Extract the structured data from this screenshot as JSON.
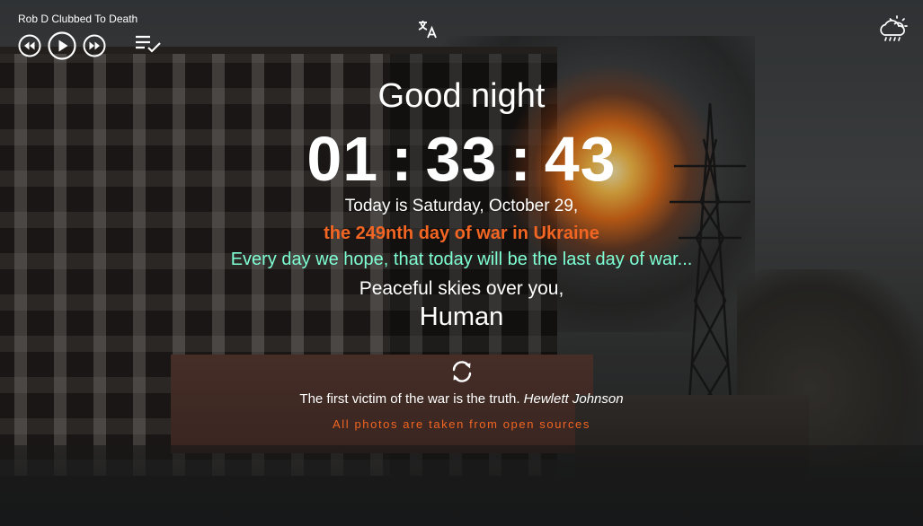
{
  "player": {
    "track_title": "Rob D Clubbed To Death",
    "icons": [
      "rewind-icon",
      "play-icon",
      "fast-forward-icon",
      "playlist-icon"
    ]
  },
  "header": {
    "translate_icon": "translate-icon",
    "weather_icon": "cloud-rain-sun-icon"
  },
  "main": {
    "greeting": "Good night",
    "clock": {
      "hours": "01",
      "minutes": "33",
      "seconds": "43",
      "separator": ":"
    },
    "today": "Today is Saturday, October 29,",
    "war_day": "the 249nth day of war in Ukraine",
    "hope": "Every day we hope, that today will be the last day of war...",
    "peace": "Peaceful skies over you,",
    "name": "Human",
    "refresh_icon": "refresh-icon",
    "quote": {
      "text": "The first victim of the war is the truth.",
      "author": "Hewlett Johnson"
    },
    "sources": "All photos are taken from open sources"
  },
  "colors": {
    "war_day": "#f26522",
    "hope": "#7fffd4",
    "sources": "#f26522",
    "text": "#ffffff"
  }
}
